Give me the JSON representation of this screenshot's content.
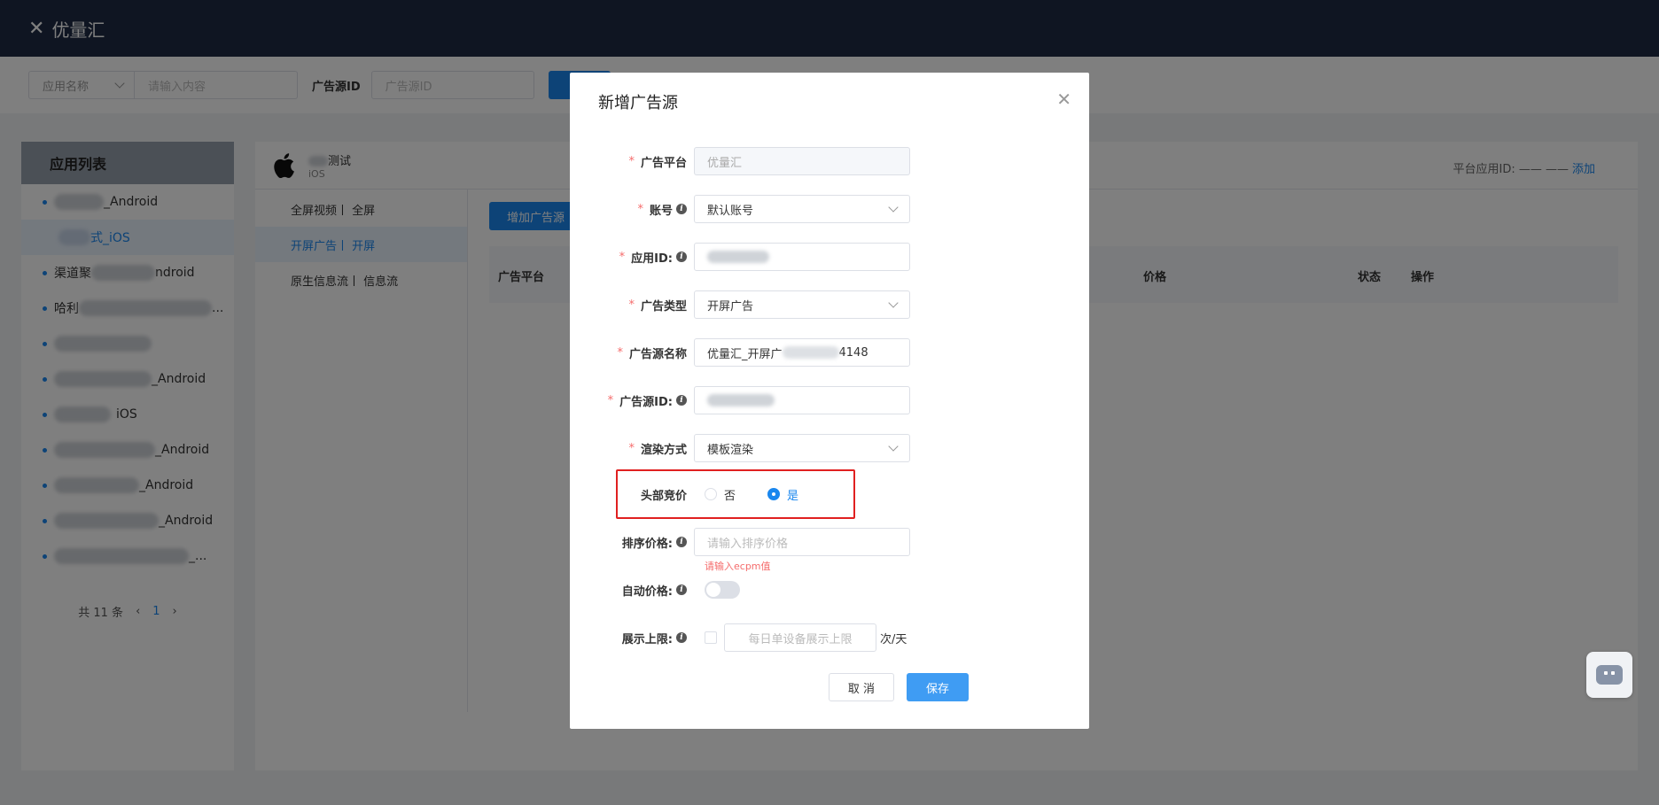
{
  "header": {
    "title": "优量汇",
    "close_icon": "✕"
  },
  "filter": {
    "select_value": "应用名称",
    "search_placeholder": "请输入内容",
    "source_id_label": "广告源ID",
    "source_id_placeholder": "广告源ID"
  },
  "app_list": {
    "title": "应用列表",
    "items": [
      {
        "suffix": "_Android"
      },
      {
        "suffix": "式_iOS"
      },
      {
        "prefix": "渠道聚",
        "suffix": "ndroid"
      },
      {
        "prefix": "哈利",
        "suffix": "..."
      },
      {
        "prefix": "",
        "suffix": ""
      },
      {
        "prefix": "",
        "suffix": "_Android"
      },
      {
        "prefix": "",
        "suffix": "iOS"
      },
      {
        "prefix": "",
        "suffix": "_Android"
      },
      {
        "prefix": "",
        "suffix": "_Android"
      },
      {
        "prefix": "",
        "suffix": "_Android"
      },
      {
        "prefix": "",
        "suffix": "_..."
      }
    ],
    "pager_total": "共 11 条",
    "pager_current": "1"
  },
  "app_detail": {
    "name_suffix": "测试",
    "os": "iOS",
    "platform_id_label": "平台应用ID: —— ——",
    "add_link": "添加",
    "tabs": [
      "全屏视频丨 全屏",
      "开屏广告丨 开屏",
      "原生信息流丨 信息流"
    ],
    "add_source_button": "增加广告源",
    "table_headers": {
      "platform": "广告平台",
      "price": "价格",
      "status": "状态",
      "actions": "操作"
    }
  },
  "dialog": {
    "title": "新增广告源",
    "fields": {
      "platform": {
        "label": "广告平台",
        "value": "优量汇"
      },
      "account": {
        "label": "账号",
        "value": "默认账号"
      },
      "app_id": {
        "label": "应用ID:"
      },
      "ad_type": {
        "label": "广告类型",
        "value": "开屏广告"
      },
      "source_name": {
        "label": "广告源名称",
        "value_prefix": "优量汇_开屏广",
        "value_suffix": "4148"
      },
      "source_id": {
        "label": "广告源ID:"
      },
      "render_mode": {
        "label": "渲染方式",
        "value": "模板渲染"
      },
      "header_bidding": {
        "label": "头部竞价",
        "option_no": "否",
        "option_yes": "是"
      },
      "sort_price": {
        "label": "排序价格:",
        "placeholder": "请输入排序价格",
        "error": "请输入ecpm值"
      },
      "auto_price": {
        "label": "自动价格:"
      },
      "display_limit": {
        "label": "展示上限:",
        "placeholder": "每日单设备展示上限",
        "unit": "次/天"
      }
    },
    "cancel_label": "取 消",
    "save_label": "保存"
  },
  "colors": {
    "accent": "#1a87ee",
    "header_bg": "#1e2b45",
    "error": "#f56c6c",
    "highlight": "#e02020"
  }
}
